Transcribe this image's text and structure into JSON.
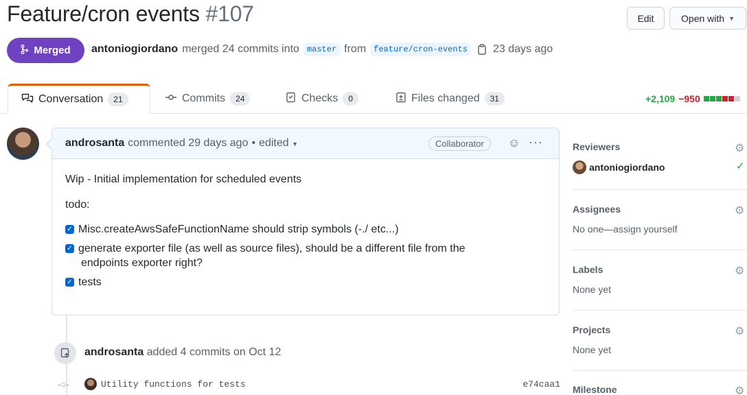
{
  "header": {
    "title": "Feature/cron events",
    "number": "#107",
    "edit_label": "Edit",
    "open_with_label": "Open with"
  },
  "state": {
    "badge": "Merged",
    "author": "antoniogiordano",
    "merged_text": "merged 24 commits into",
    "base_branch": "master",
    "from_text": "from",
    "head_branch": "feature/cron-events",
    "age": "23 days ago"
  },
  "tabs": [
    {
      "label": "Conversation",
      "count": "21"
    },
    {
      "label": "Commits",
      "count": "24"
    },
    {
      "label": "Checks",
      "count": "0"
    },
    {
      "label": "Files changed",
      "count": "31"
    }
  ],
  "diffstat": {
    "additions": "+2,109",
    "deletions": "−950",
    "blocks": [
      "#28a745",
      "#28a745",
      "#28a745",
      "#cb2431",
      "#cb2431",
      "#d1d5da"
    ]
  },
  "comment": {
    "author": "androsanta",
    "meta": "commented 29 days ago",
    "edited": "edited",
    "role": "Collaborator",
    "line1": "Wip - Initial implementation for scheduled events",
    "line2": "todo:",
    "tasks": [
      "Misc.createAwsSafeFunctionName should strip symbols (-./ etc...)",
      "generate exporter file (as well as source files), should be a different file from the",
      "endpoints exporter right?",
      "tests"
    ]
  },
  "event": {
    "author": "androsanta",
    "text": "added 4 commits on Oct 12"
  },
  "commit": {
    "message": "Utility functions for tests",
    "sha": "e74caa1"
  },
  "sidebar": {
    "reviewers_title": "Reviewers",
    "reviewer": "antoniogiordano",
    "assignees_title": "Assignees",
    "assignees_value": "No one—assign yourself",
    "labels_title": "Labels",
    "labels_value": "None yet",
    "projects_title": "Projects",
    "projects_value": "None yet",
    "milestone_title": "Milestone"
  },
  "colors": {
    "accent": "#6f42c1",
    "link": "#0366d6",
    "tab_active_border": "#e36209"
  }
}
